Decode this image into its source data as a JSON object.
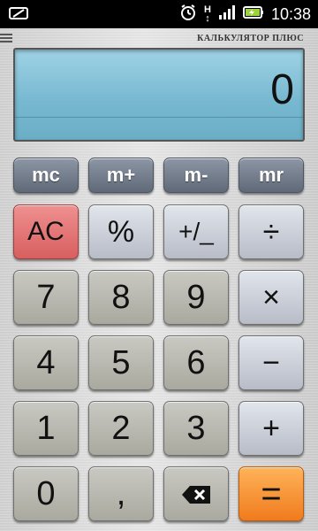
{
  "status_bar": {
    "time": "10:38",
    "icons": [
      "notification-icon",
      "alarm-icon",
      "data-transfer-icon",
      "signal-icon",
      "battery-charging-icon"
    ],
    "network_type": "H"
  },
  "app": {
    "title": "КАЛЬКУЛЯТОР ПЛЮС",
    "display_value": "0"
  },
  "memory_buttons": [
    {
      "label": "mc"
    },
    {
      "label": "m+"
    },
    {
      "label": "m-"
    },
    {
      "label": "mr"
    }
  ],
  "keys": {
    "ac": "AC",
    "percent": "%",
    "plus_minus": "+/_",
    "divide": "÷",
    "seven": "7",
    "eight": "8",
    "nine": "9",
    "multiply": "×",
    "four": "4",
    "five": "5",
    "six": "6",
    "minus": "−",
    "one": "1",
    "two": "2",
    "three": "3",
    "plus": "+",
    "zero": "0",
    "comma": ",",
    "backspace_icon": "backspace-icon",
    "equals": "="
  },
  "colors": {
    "display": "#78b9d1",
    "ac": "#d85f5f",
    "equals": "#f07b1d",
    "memory": "#5f6977"
  }
}
